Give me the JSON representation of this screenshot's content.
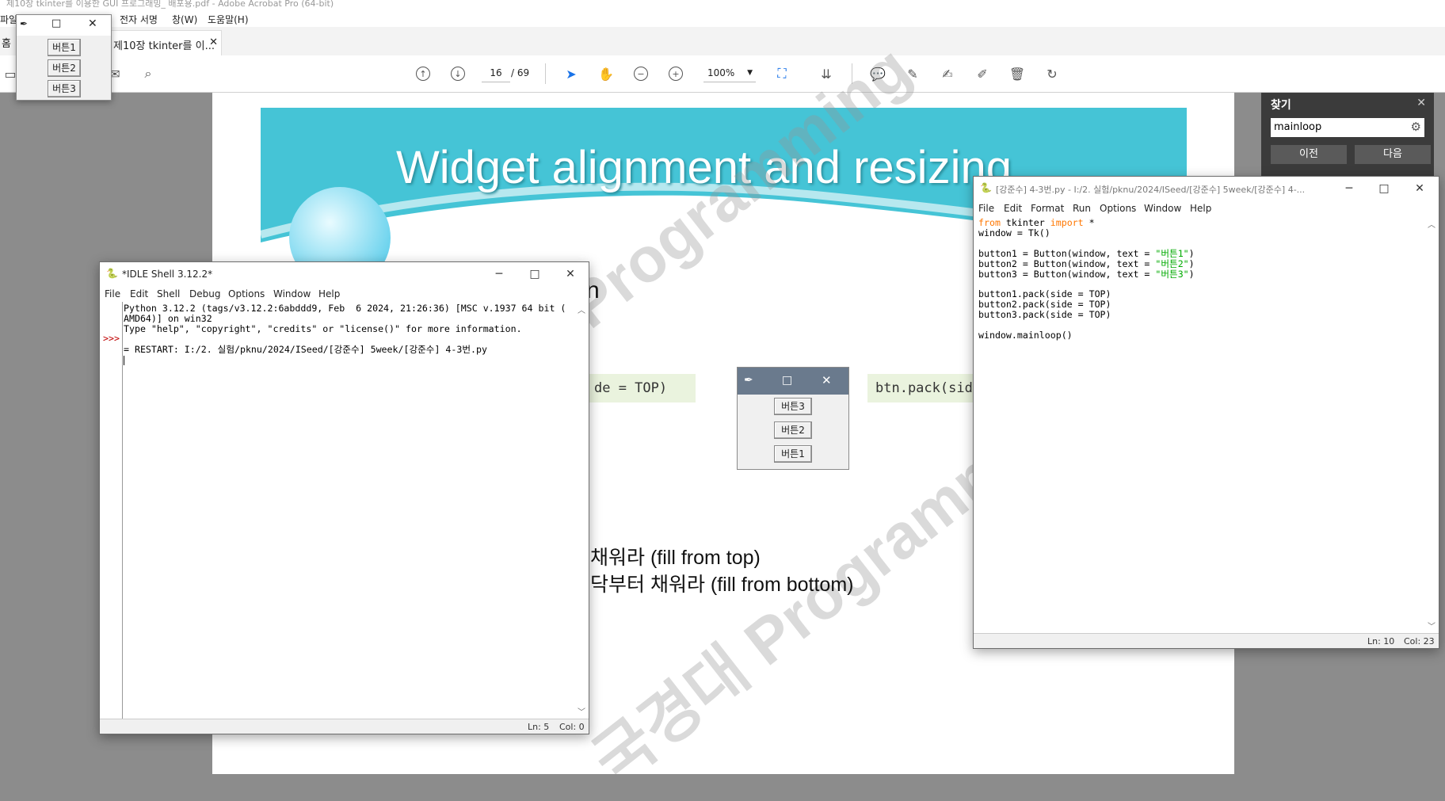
{
  "acrobat": {
    "title": "제10장 tkinter를 이용한 GUI 프로그래밍_ 배포용.pdf - Adobe Acrobat Pro (64-bit)",
    "menu": [
      "파일(F)",
      "전자 서명",
      "창(W)",
      "도움말(H)"
    ],
    "home_tab": "홈",
    "doc_tab": "제10장 tkinter를 이...",
    "page_current": "16",
    "page_total": "/ 69",
    "zoom": "100%"
  },
  "find": {
    "title": "찾기",
    "query": "mainloop",
    "prev": "이전",
    "next": "다음"
  },
  "slide": {
    "title": "Widget alignment and resizing",
    "code_left": "de = TOP)",
    "code_right": "btn.pack(sid",
    "buttons": [
      "버튼3",
      "버튼2",
      "버튼1"
    ],
    "line1": "채워라 (fill from top)",
    "line2": "닥부터 채워라 (fill from bottom)",
    "partial_char": "n",
    "watermark1": "Programming",
    "watermark2": "국경대 Programming"
  },
  "tk_small": {
    "buttons": [
      "버튼1",
      "버튼2",
      "버튼3"
    ]
  },
  "idle_shell": {
    "title": "*IDLE Shell 3.12.2*",
    "menu": [
      "File",
      "Edit",
      "Shell",
      "Debug",
      "Options",
      "Window",
      "Help"
    ],
    "prompt": ">>>",
    "lines": [
      "Python 3.12.2 (tags/v3.12.2:6abddd9, Feb  6 2024, 21:26:36) [MSC v.1937 64 bit (",
      "AMD64)] on win32",
      "Type \"help\", \"copyright\", \"credits\" or \"license()\" for more information.",
      "",
      "= RESTART: I:/2. 실험/pknu/2024/ISeed/[강준수] 5week/[강준수] 4-3번.py"
    ],
    "status_ln": "Ln: 5",
    "status_col": "Col: 0"
  },
  "editor": {
    "title": "[강준수] 4-3번.py - I:/2. 실험/pknu/2024/ISeed/[강준수] 5week/[강준수] 4-...",
    "menu": [
      "File",
      "Edit",
      "Format",
      "Run",
      "Options",
      "Window",
      "Help"
    ],
    "code": {
      "l1_kw1": "from",
      "l1_mod": " tkinter ",
      "l1_kw2": "import",
      "l1_rest": " *",
      "l2": "window = Tk()",
      "b1_pre": "button1 = Button(window, text = ",
      "b1_str": "\"버튼1\"",
      "b2_pre": "button2 = Button(window, text = ",
      "b2_str": "\"버튼2\"",
      "b3_pre": "button3 = Button(window, text = ",
      "b3_str": "\"버튼3\"",
      "close": ")",
      "p1": "button1.pack(side = TOP)",
      "p2": "button2.pack(side = TOP)",
      "p3": "button3.pack(side = TOP)",
      "ml": "window.mainloop()"
    },
    "status_ln": "Ln: 10",
    "status_col": "Col: 23"
  }
}
